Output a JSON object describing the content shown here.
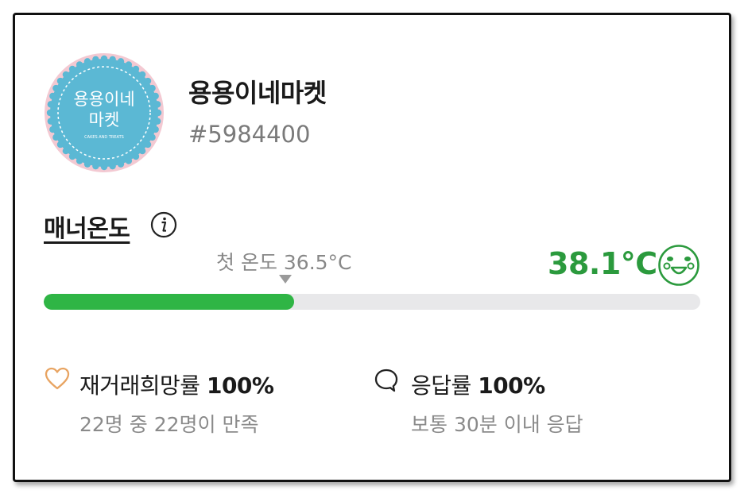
{
  "profile": {
    "shop_name": "용용이네마켓",
    "shop_id": "#5984400",
    "avatar": {
      "line1": "용용이네",
      "line2": "마켓",
      "caption": "CAKES AND TREATS",
      "badge_color": "#5bb8d4",
      "rim_color": "#f3c9d2"
    }
  },
  "manner": {
    "label": "매너온도",
    "info_icon": "info-icon",
    "first_temp_label": "첫 온도 36.5°C",
    "value_text": "38.1°C",
    "value_color": "#2b9a3d",
    "face_icon": "smile-face-icon",
    "bar_fill_percent": 38.1,
    "bar_color": "#2fb545"
  },
  "stats": [
    {
      "icon": "heart-icon",
      "label": "재거래희망률",
      "value": "100%",
      "sub": "22명 중 22명이 만족"
    },
    {
      "icon": "chat-bubble-icon",
      "label": "응답률",
      "value": "100%",
      "sub": "보통 30분 이내 응답"
    }
  ]
}
